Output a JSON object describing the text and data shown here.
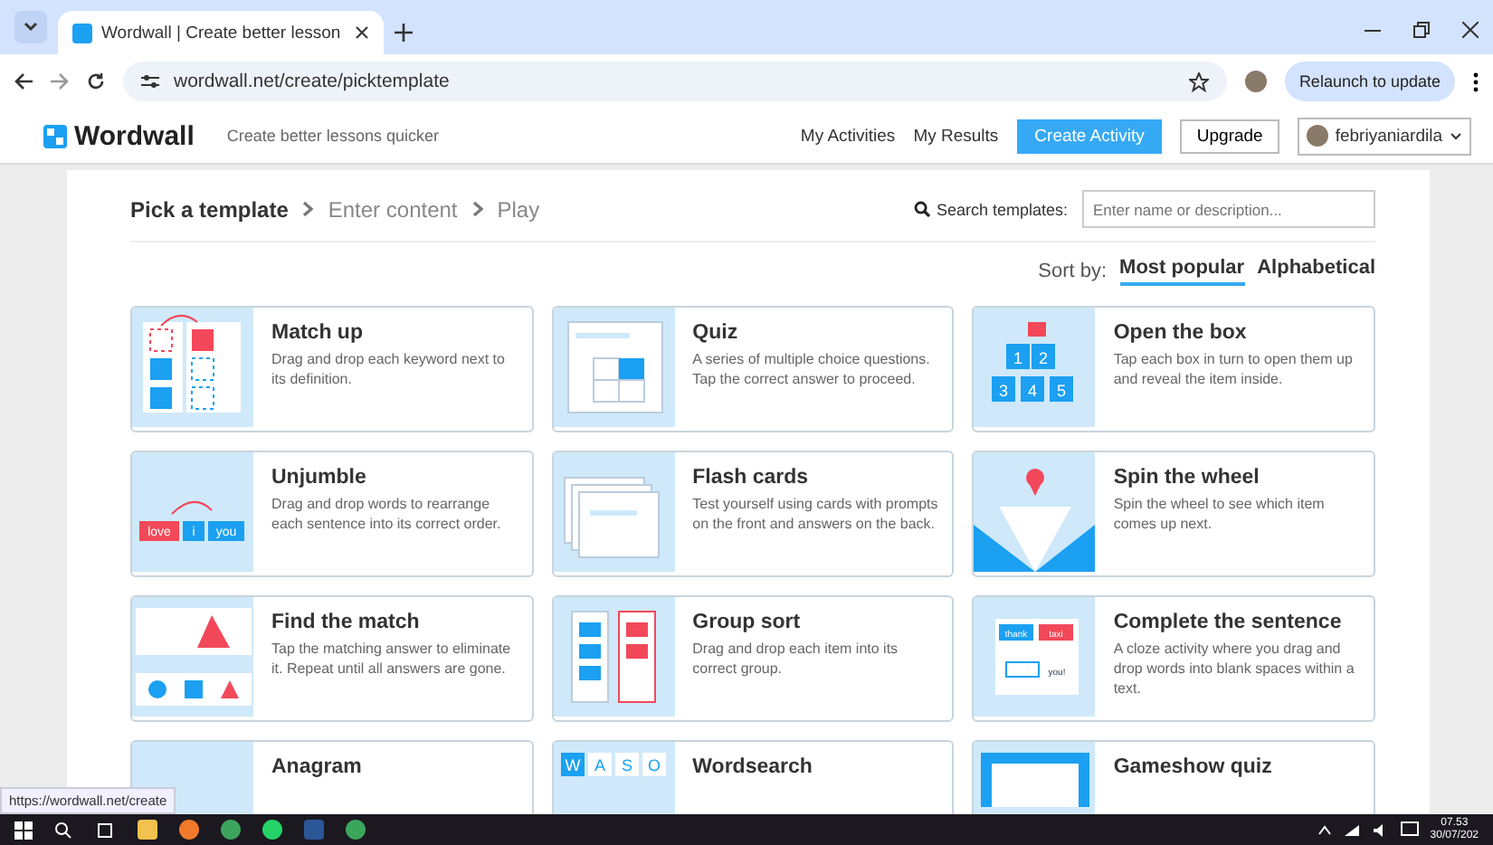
{
  "browser": {
    "tab_title": "Wordwall | Create better lesson",
    "url": "wordwall.net/create/picktemplate",
    "relaunch_button": "Relaunch to update"
  },
  "site_header": {
    "logo": "Wordwall",
    "tagline": "Create better lessons quicker",
    "nav": [
      "My Activities",
      "My Results"
    ],
    "create_button": "Create Activity",
    "upgrade_button": "Upgrade",
    "user": "febriyaniardila"
  },
  "steps": [
    {
      "label": "Pick a template",
      "selected": true
    },
    {
      "label": "Enter content",
      "selected": false
    },
    {
      "label": "Play",
      "selected": false
    }
  ],
  "search": {
    "label": "Search templates:",
    "placeholder": "Enter name or description..."
  },
  "sort": {
    "label": "Sort by:",
    "options": [
      {
        "label": "Most popular",
        "selected": true
      },
      {
        "label": "Alphabetical",
        "selected": false
      }
    ]
  },
  "templates": [
    {
      "kind": "matchup",
      "title": "Match up",
      "description": "Drag and drop each keyword next to its definition."
    },
    {
      "kind": "quiz",
      "title": "Quiz",
      "description": "A series of multiple choice questions. Tap the correct answer to proceed."
    },
    {
      "kind": "openbox",
      "title": "Open the box",
      "description": "Tap each box in turn to open them up and reveal the item inside.",
      "art_labels": [
        "1",
        "2",
        "3",
        "4",
        "5"
      ]
    },
    {
      "kind": "unjumble",
      "title": "Unjumble",
      "description": "Drag and drop words to rearrange each sentence into its correct order.",
      "art_labels": [
        "love",
        "i",
        "you"
      ]
    },
    {
      "kind": "flashcards",
      "title": "Flash cards",
      "description": "Test yourself using cards with prompts on the front and answers on the back."
    },
    {
      "kind": "wheel",
      "title": "Spin the wheel",
      "description": "Spin the wheel to see which item comes up next."
    },
    {
      "kind": "findmatch",
      "title": "Find the match",
      "description": "Tap the matching answer to eliminate it. Repeat until all answers are gone."
    },
    {
      "kind": "groupsort",
      "title": "Group sort",
      "description": "Drag and drop each item into its correct group."
    },
    {
      "kind": "sentence",
      "title": "Complete the sentence",
      "description": "A cloze activity where you drag and drop words into blank spaces within a text.",
      "art_labels": [
        "thank",
        "taxi",
        "you!"
      ]
    },
    {
      "kind": "anagram",
      "title": "Anagram"
    },
    {
      "kind": "wordsearch",
      "title": "Wordsearch",
      "art_labels": [
        "W",
        "A",
        "S",
        "O"
      ]
    },
    {
      "kind": "gameshow",
      "title": "Gameshow quiz"
    }
  ],
  "status_link": "https://wordwall.net/create",
  "taskbar": {
    "time": "07.53",
    "date": "30/07/202"
  }
}
